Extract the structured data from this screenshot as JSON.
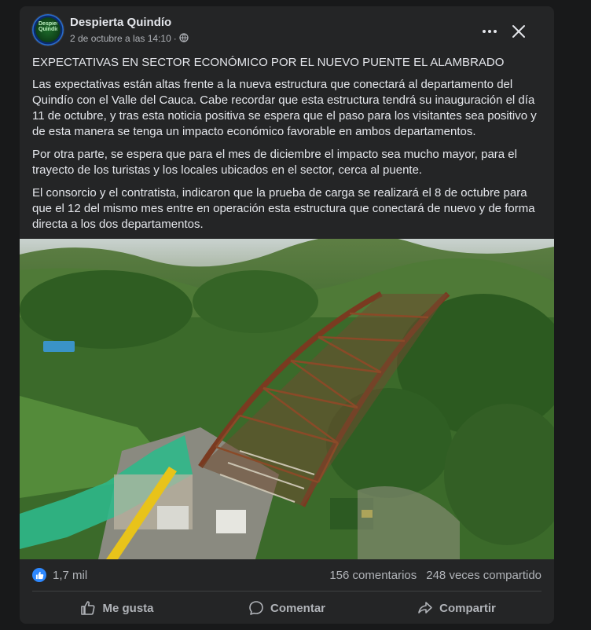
{
  "post": {
    "page_name": "Despierta Quindío",
    "timestamp": "2 de octubre a las 14:10",
    "separator": "·",
    "avatar_text": "Despierta Quindío",
    "title": "EXPECTATIVAS EN SECTOR ECONÓMICO  POR EL NUEVO PUENTE EL ALAMBRADO",
    "paragraphs": [
      "Las expectativas están altas frente a la nueva estructura que conectará al departamento del Quindío con el Valle del Cauca. Cabe recordar que esta estructura tendrá su inauguración el día 11 de octubre, y tras esta noticia positiva se espera que el paso para los visitantes sea positivo y de esta manera se tenga un impacto económico favorable en ambos departamentos.",
      "Por otra parte, se espera que para el mes de diciembre el impacto sea mucho mayor, para el trayecto de los turistas y los locales ubicados en el sector, cerca al puente.",
      "El consorcio y el contratista, indicaron que la prueba de carga se realizará el 8 de octubre para que el 12 del mismo mes entre en operación esta estructura que conectará de nuevo y de forma directa a los dos departamentos."
    ]
  },
  "stats": {
    "likes": "1,7 mil",
    "comments": "156 comentarios",
    "shares": "248 veces compartido"
  },
  "actions": {
    "like": "Me gusta",
    "comment": "Comentar",
    "share": "Compartir"
  },
  "icons": {
    "more": "more-horizontal-icon",
    "close": "close-icon",
    "privacy": "globe-icon",
    "like": "thumbs-up-icon",
    "comment": "comment-bubble-icon",
    "share": "share-arrow-icon"
  },
  "colors": {
    "background": "#18191a",
    "card": "#242526",
    "text": "#e4e6eb",
    "secondary_text": "#b0b3b8",
    "like_blue": "#2d88ff"
  }
}
